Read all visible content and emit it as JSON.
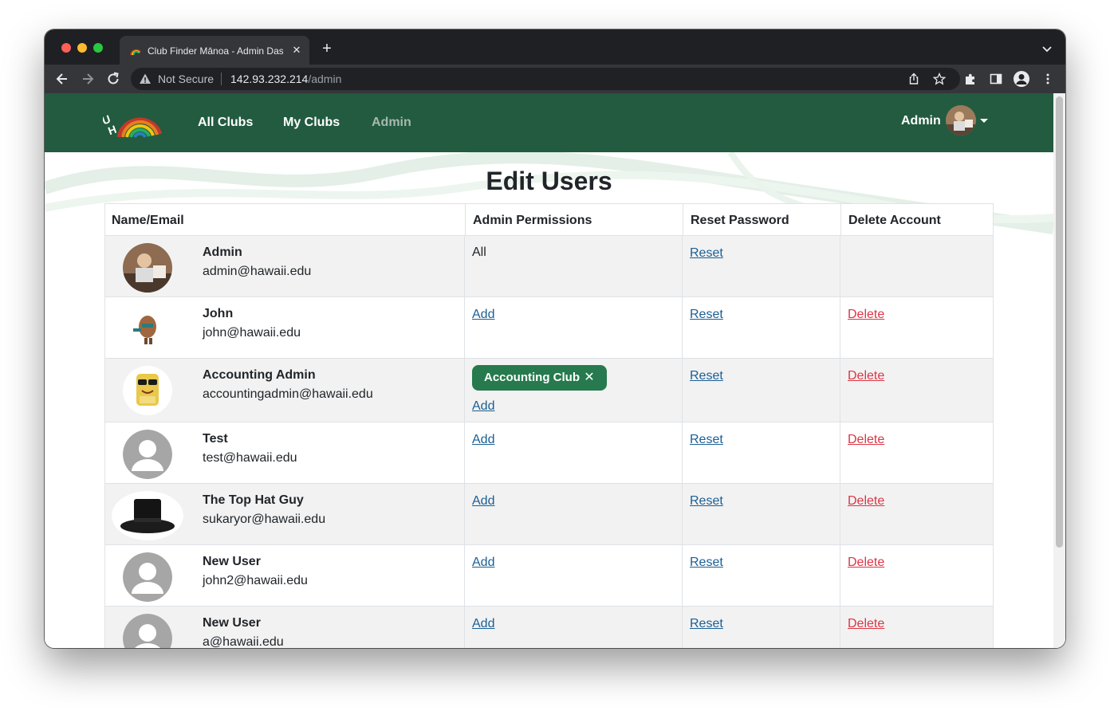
{
  "browser": {
    "tab_title": "Club Finder Mānoa - Admin Dash",
    "tab_close": "✕",
    "new_tab": "+",
    "security_label": "Not Secure",
    "url_host": "142.93.232.214",
    "url_path": "/admin"
  },
  "navbar": {
    "links": [
      "All Clubs",
      "My Clubs",
      "Admin"
    ],
    "user_name": "Admin"
  },
  "page": {
    "title": "Edit Users"
  },
  "table": {
    "headers": [
      "Name/Email",
      "Admin Permissions",
      "Reset Password",
      "Delete Account"
    ],
    "rows": [
      {
        "name": "Admin",
        "email": "admin@hawaii.edu",
        "permissions": "All",
        "reset": "Reset",
        "delete": ""
      },
      {
        "name": "John",
        "email": "john@hawaii.edu",
        "permissions": "Add",
        "reset": "Reset",
        "delete": "Delete"
      },
      {
        "name": "Accounting Admin",
        "email": "accountingadmin@hawaii.edu",
        "club_chip": "Accounting Club",
        "chip_remove": "✕",
        "permissions": "Add",
        "reset": "Reset",
        "delete": "Delete"
      },
      {
        "name": "Test",
        "email": "test@hawaii.edu",
        "permissions": "Add",
        "reset": "Reset",
        "delete": "Delete"
      },
      {
        "name": "The Top Hat Guy",
        "email": "sukaryor@hawaii.edu",
        "permissions": "Add",
        "reset": "Reset",
        "delete": "Delete"
      },
      {
        "name": "New User",
        "email": "john2@hawaii.edu",
        "permissions": "Add",
        "reset": "Reset",
        "delete": "Delete"
      },
      {
        "name": "New User",
        "email": "a@hawaii.edu",
        "permissions": "Add",
        "reset": "Reset",
        "delete": "Delete"
      }
    ]
  },
  "colors": {
    "navbar": "#225b40",
    "chip": "#267a4d",
    "delete_link": "#dc3545",
    "link": "#1a5f94"
  },
  "icons": [
    "back-icon",
    "forward-icon",
    "reload-icon",
    "warning-icon",
    "share-icon",
    "bookmark-star-icon",
    "extensions-icon",
    "side-panel-icon",
    "profile-icon",
    "kebab-menu-icon",
    "chevron-down-icon",
    "uh-rainbow-logo"
  ]
}
